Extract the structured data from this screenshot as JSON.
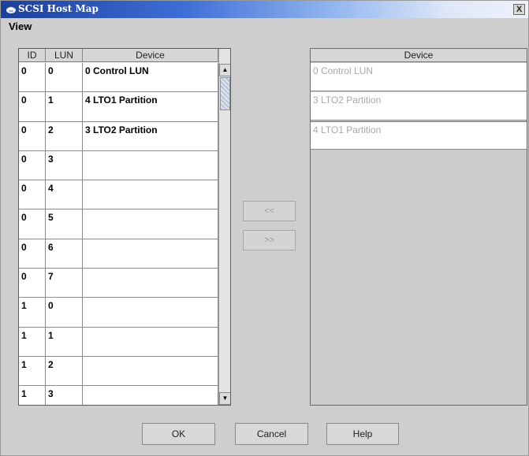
{
  "window": {
    "title": "SCSI Host Map",
    "close_label": "X"
  },
  "menu": {
    "view_label": "View"
  },
  "left_table": {
    "headers": {
      "id": "ID",
      "lun": "LUN",
      "device": "Device"
    },
    "rows": [
      {
        "id": "0",
        "lun": "0",
        "device": "0 Control LUN"
      },
      {
        "id": "0",
        "lun": "1",
        "device": "4  LTO1 Partition"
      },
      {
        "id": "0",
        "lun": "2",
        "device": "3  LTO2 Partition"
      },
      {
        "id": "0",
        "lun": "3",
        "device": ""
      },
      {
        "id": "0",
        "lun": "4",
        "device": ""
      },
      {
        "id": "0",
        "lun": "5",
        "device": ""
      },
      {
        "id": "0",
        "lun": "6",
        "device": ""
      },
      {
        "id": "0",
        "lun": "7",
        "device": ""
      },
      {
        "id": "1",
        "lun": "0",
        "device": ""
      },
      {
        "id": "1",
        "lun": "1",
        "device": ""
      },
      {
        "id": "1",
        "lun": "2",
        "device": ""
      },
      {
        "id": "1",
        "lun": "3",
        "device": ""
      }
    ]
  },
  "scrollbar": {
    "up_arrow": "▲",
    "down_arrow": "▼"
  },
  "transfer": {
    "move_left_label": "<<",
    "move_right_label": ">>"
  },
  "right_list": {
    "header": "Device",
    "items": [
      "0 Control LUN",
      "3  LTO2 Partition",
      "4  LTO1 Partition"
    ]
  },
  "buttons": {
    "ok": "OK",
    "cancel": "Cancel",
    "help": "Help"
  },
  "colors": {
    "title_gradient_start": "#1b3f9c",
    "dialog_background": "#cecece",
    "disabled_text": "#a8a8a8"
  }
}
